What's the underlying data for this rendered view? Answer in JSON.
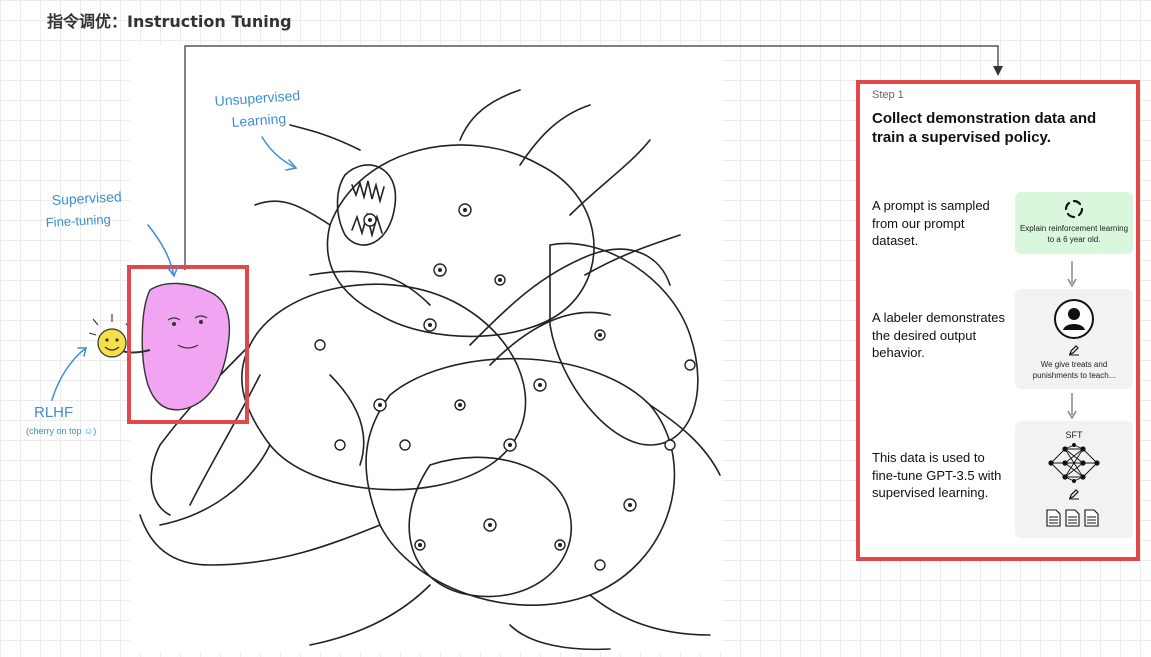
{
  "header": {
    "title": "指令调优：Instruction Tuning"
  },
  "drawing": {
    "labels": {
      "unsupervised_line1": "Unsupervised",
      "unsupervised_line2": "Learning",
      "supervised_line1": "Supervised",
      "supervised_line2": "Fine-tuning",
      "rlhf": "RLHF",
      "rlhf_note": "(cherry on top ☺)"
    }
  },
  "step_card": {
    "step_label": "Step 1",
    "heading": "Collect demonstration data and train a supervised policy.",
    "rows": [
      {
        "description": "A prompt is sampled from our prompt dataset.",
        "box_text": "Explain reinforcement learning to a 6 year old."
      },
      {
        "description": "A labeler demonstrates the desired output behavior.",
        "box_text": "We give treats and punishments to teach..."
      },
      {
        "description": "This data is used to fine-tune GPT-3.5 with supervised learning.",
        "box_title": "SFT"
      }
    ]
  },
  "colors": {
    "highlight_red": "#e0484b",
    "annotation_blue": "#3d8fd1",
    "face_pink": "#f1a4f2",
    "smiley_yellow": "#f4e14a",
    "prompt_green": "#d8f7dd"
  }
}
